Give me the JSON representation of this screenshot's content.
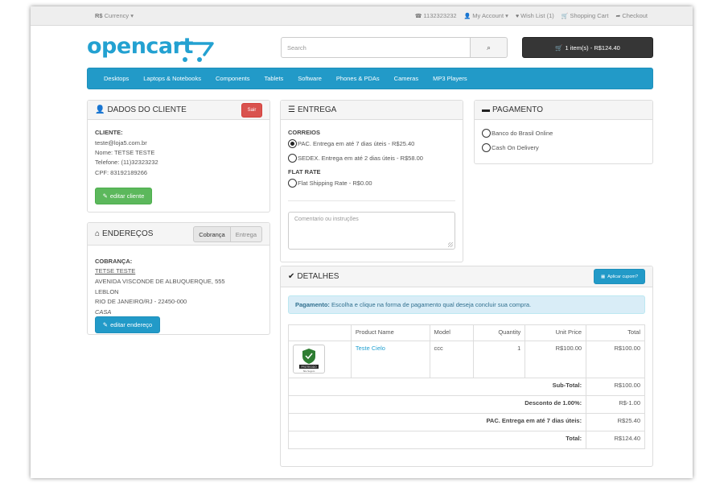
{
  "topbar": {
    "currency_symbol": "R$",
    "currency_label": "Currency",
    "phone": "1132323232",
    "my_account": "My Account",
    "wishlist": "Wish List (1)",
    "shopping_cart": "Shopping Cart",
    "checkout": "Checkout"
  },
  "header": {
    "logo_text": "opencart",
    "search_placeholder": "Search",
    "cart_button": "1 item(s) - R$124.40"
  },
  "nav": [
    "Desktops",
    "Laptops & Notebooks",
    "Components",
    "Tablets",
    "Software",
    "Phones & PDAs",
    "Cameras",
    "MP3 Players"
  ],
  "cliente": {
    "title": "DADOS DO CLIENTE",
    "logout": "Sair",
    "label": "CLIENTE:",
    "email": "teste@loja5.com.br",
    "nome": "Nome: TETSE TESTE",
    "telefone": "Telefone: (11)32323232",
    "cpf": "CPF: 83192189266",
    "edit_button": "editar cliente"
  },
  "enderecos": {
    "title": "ENDEREÇOS",
    "tab_cobranca": "Cobrança",
    "tab_entrega": "Entrega",
    "label": "COBRANÇA:",
    "name": "TETSE TESTE",
    "street": "AVENIDA VISCONDE DE ALBUQUERQUE, 555",
    "district": "LEBLON",
    "city": "RIO DE JANEIRO/RJ - 22450-000",
    "type": "CASA",
    "edit_button": "editar endereço"
  },
  "entrega": {
    "title": "ENTREGA",
    "group1": "CORREIOS",
    "option1": "PAC. Entrega em até 7 dias úteis - R$25.40",
    "option2": "SEDEX. Entrega em até 2 dias úteis - R$58.00",
    "group2": "FLAT RATE",
    "option3": "Flat Shipping Rate - R$0.00",
    "comment_placeholder": "Comentario ou instruções"
  },
  "pagamento": {
    "title": "PAGAMENTO",
    "option1": "Banco do Brasil Online",
    "option2": "Cash On Delivery"
  },
  "detalhes": {
    "title": "DETALHES",
    "coupon_button": "Aplicar cupom?",
    "alert_bold": "Pagamento:",
    "alert_text": " Escolha e clique na forma de pagamento qual deseja concluir sua compra.",
    "columns": [
      "Product Name",
      "Model",
      "Quantity",
      "Unit Price",
      "Total"
    ],
    "product": {
      "name": "Teste Cielo",
      "model": "ccc",
      "quantity": "1",
      "unit_price": "R$100.00",
      "total": "R$100.00",
      "thumb_text": "PROTEGIDO",
      "thumb_sub": "Site Seguro"
    },
    "totals": [
      {
        "label": "Sub-Total:",
        "value": "R$100.00"
      },
      {
        "label": "Desconto de 1.00%:",
        "value": "R$-1.00"
      },
      {
        "label": "PAC. Entrega em até 7 dias úteis:",
        "value": "R$25.40"
      },
      {
        "label": "Total:",
        "value": "R$124.40"
      }
    ]
  },
  "colors": {
    "brand_blue": "#229ac8",
    "success_green": "#5cb85c",
    "danger_red": "#d9534f",
    "cart_dark": "#363636",
    "alert_blue": "#d9edf7"
  },
  "icons": {
    "phone": "phone-icon",
    "account": "user-icon",
    "wishlist": "heart-icon",
    "cart": "shopping-cart-icon",
    "checkout": "share-icon",
    "search": "search-icon",
    "user": "user-icon",
    "home": "home-icon",
    "list": "list-alt-icon",
    "card": "credit-card-icon",
    "check": "check-circle-icon",
    "pencil": "pencil-icon",
    "gift": "gift-icon"
  }
}
